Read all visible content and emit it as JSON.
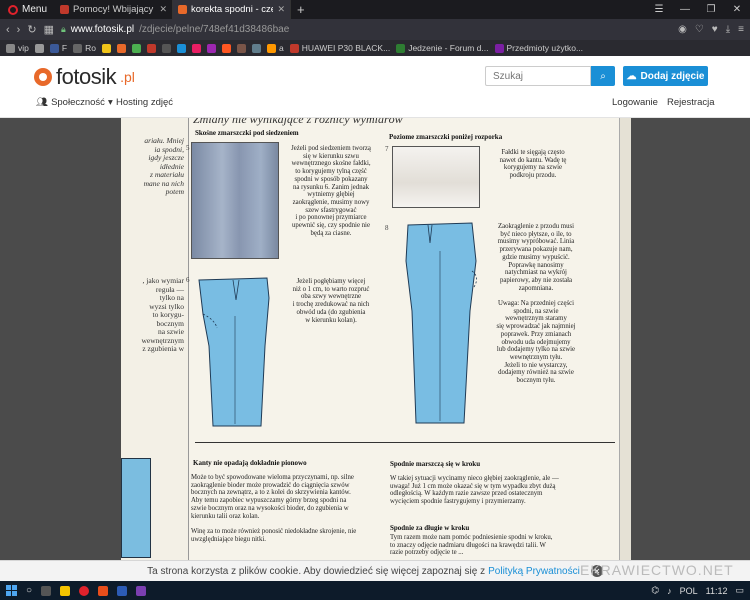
{
  "browser": {
    "menu_label": "Menu",
    "tabs": [
      {
        "title": "Pomocy! Wbijający się szew",
        "color": "#c0392b"
      },
      {
        "title": "korekta spodni - czeremch",
        "color": "#e8692a"
      }
    ],
    "new_tab": "+",
    "url_domain": "www.fotosik.pl",
    "url_path": "/zdjecie/pelne/748ef41d38486bae",
    "bookmarks": [
      {
        "label": "vip",
        "color": "#888"
      },
      {
        "label": "",
        "color": "#999"
      },
      {
        "label": "F",
        "color": "#3b5998"
      },
      {
        "label": "Ro",
        "color": "#666"
      },
      {
        "label": "",
        "color": "#f0c419"
      },
      {
        "label": "",
        "color": "#e8692a"
      },
      {
        "label": "",
        "color": "#4caf50"
      },
      {
        "label": "",
        "color": "#c0392b"
      },
      {
        "label": "",
        "color": "#555"
      },
      {
        "label": "",
        "color": "#1a8fd6"
      },
      {
        "label": "",
        "color": "#e91e63"
      },
      {
        "label": "",
        "color": "#9c27b0"
      },
      {
        "label": "",
        "color": "#ff5722"
      },
      {
        "label": "",
        "color": "#795548"
      },
      {
        "label": "",
        "color": "#607d8b"
      },
      {
        "label": "a",
        "color": "#ff9800"
      },
      {
        "label": "HUAWEI P30 BLACK...",
        "color": "#c0392b"
      },
      {
        "label": "Jedzenie - Forum d...",
        "color": "#2e7d32"
      },
      {
        "label": "Przedmioty użytko...",
        "color": "#7b1fa2"
      }
    ]
  },
  "site": {
    "logo": "fotosik",
    "logo_tld": ".pl",
    "search_placeholder": "Szukaj",
    "add_photo": "Dodaj zdjęcie",
    "nav": {
      "community": "Społeczność",
      "hosting": "Hosting zdjęć",
      "login": "Logowanie",
      "register": "Rejestracja"
    }
  },
  "scan": {
    "title": "Zmiany nie wynikające z różnicy wymiarów",
    "left_page_lines": [
      "ariału. Mniej",
      "ia spodni,",
      "igdy jeszcze",
      "idłednie",
      "z materiału",
      "mane na nich",
      "potem"
    ],
    "left_page_lines2": [
      ", jako wymiar",
      "reguła —",
      "tylko na",
      "wyzsi tylko",
      "to korygu-",
      "bocznym",
      "na szwie",
      "wewnętrznym",
      "z zgubienia w"
    ],
    "sections": {
      "h1": "Skośne zmarszczki pod siedzeniem",
      "n1": "5",
      "t1": [
        "Jeżeli pod siedzeniem tworzą",
        "się w kierunku szwu",
        "wewnętrznego skośne fałdki,",
        "to korygujemy tylną część",
        "spodni w sposób pokazany",
        "na rysunku 6. Zanim jednak",
        "wytniemy głębiej",
        "zaokrąglenie, musimy nowy",
        "szew sfastrygować",
        "i po ponownej przymiarce",
        "upewnić się, czy spodnie nie",
        "będą za ciasne."
      ],
      "n2": "6",
      "t2": [
        "Jeżeli pogłębiamy więcej",
        "niż o 1 cm, to warto rozpruć",
        "oba szwy wewnętrzne",
        "i trochę zredukować na nich",
        "obwód uda (do zgubienia",
        "w kierunku kolan)."
      ],
      "h2": "Poziome zmarszczki poniżej rozporka",
      "n3": "7",
      "t3": [
        "Fałdki te sięgają często",
        "nawet do kantu. Wadę tę",
        "korygujemy na szwie",
        "podkroju przodu."
      ],
      "n4": "8",
      "t4": [
        "Zaokrąglenie z przodu musi",
        "być nieco płytsze, o ile, to",
        "musimy wypróbować. Linia",
        "przerywana pokazuje nam,",
        "gdzie musimy wypuścić.",
        "Poprawkę nanosimy",
        "natychmiast na wykrój",
        "papierowy, aby nie została",
        "zapomniana.",
        "",
        "Uwaga: Na przedniej części",
        "spodni, na szwie",
        "wewnętrznym staramy",
        "się wprowadzać jak najmniej",
        "poprawek. Przy zmianach",
        "obwodu uda odejmujemy",
        "lub dodajemy tylko na szwie",
        "wewnętrznym tyłu.",
        "Jeżeli to nie wystarczy,",
        "dodajemy również na szwie",
        "bocznym tyłu."
      ],
      "h3": "Kanty nie opadają dokładnie pionowo",
      "t5": [
        "Może to być spowodowane wieloma przyczynami, np. silne",
        "zaokrąglenie bioder może prowadzić do ciągnięcia szwów",
        "bocznych na zewnątrz, a to z kolei do skrzywienia kantów.",
        "Aby temu zapobiec wypuszczamy górny brzeg spodni na",
        "szwie bocznym oraz na wysokości bioder, do zgubienia w",
        "kierunku talii oraz kolan.",
        "",
        "Winę za to może również ponosić niedokładne skrojenie, nie",
        "uwzględniające biegu nitki."
      ],
      "h4": "Spodnie marszczą się w kroku",
      "t6": [
        "W takiej sytuacji wycinamy nieco głębiej zaokrąglenie, ale —",
        "uwaga! Już 1 cm może okazać się w tym wypadku zbyt dużą",
        "odległością. W każdym razie zawsze przed ostatecznym",
        "wycięciem spodnie fastrygujemy i przymierzamy."
      ],
      "h5": "Spodnie za długie w kroku",
      "t7": [
        "Tym razem może nam pomóc podniesienie spodni w kroku,",
        "to znaczy odjęcie nadmiaru długości na krawędzi talii. W",
        "razie potrzeby odjęcie te ..."
      ]
    }
  },
  "cookie": {
    "text": "Ta strona korzysta z plików cookie. Aby dowiedzieć się więcej zapoznaj się z",
    "link": "Polityką Prywatności",
    "close": "✕"
  },
  "watermark": "EKRAWIECTWO.NET",
  "taskbar": {
    "time": "11:12",
    "lang": "POL"
  },
  "colors": {
    "accent": "#1a8fd6",
    "logo": "#e8692a",
    "pants_blue": "#7bbde0"
  }
}
